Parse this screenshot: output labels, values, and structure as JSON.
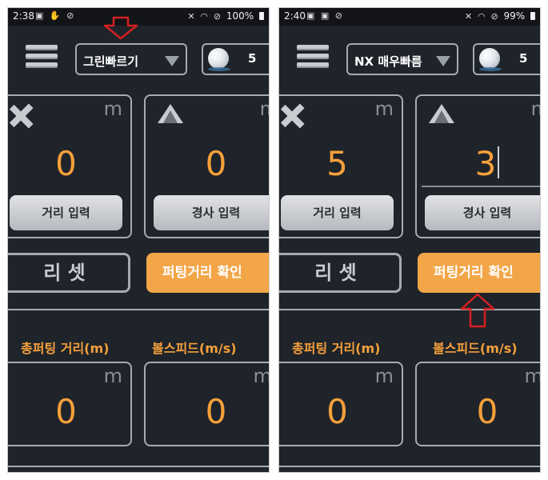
{
  "screens": [
    {
      "status": {
        "time": "2:38",
        "battery": "100%"
      },
      "dropdown": {
        "selected": "그린빠르기"
      },
      "ball_text": "5",
      "distance_card": {
        "unit": "m",
        "value": "0",
        "button": "거리 입력"
      },
      "slope_card": {
        "unit": "m",
        "value": "0",
        "button": "경사 입력"
      },
      "reset_label": "리 셋",
      "confirm_label": "퍼팅거리 확인",
      "result": {
        "total_label": "총퍼팅 거리(m)",
        "speed_label": "볼스피드(m/s)",
        "total_unit": "m",
        "speed_unit": "m/",
        "total_value": "0",
        "speed_value": "0"
      }
    },
    {
      "status": {
        "time": "2:40",
        "battery": "99%"
      },
      "dropdown": {
        "selected": "NX 매우빠름"
      },
      "ball_text": "5",
      "distance_card": {
        "unit": "m",
        "value": "5",
        "button": "거리 입력"
      },
      "slope_card": {
        "unit": "m",
        "value": "3",
        "button": "경사 입력"
      },
      "reset_label": "리 셋",
      "confirm_label": "퍼팅거리 확인",
      "result": {
        "total_label": "총퍼팅 거리(m)",
        "speed_label": "볼스피드(m/s)",
        "total_unit": "m",
        "speed_unit": "m/",
        "total_value": "0",
        "speed_value": "0"
      }
    }
  ],
  "colors": {
    "background": "#1f232a",
    "accent": "#f5a03a",
    "border": "#a6abb3",
    "annotation_arrow": "#d42020"
  }
}
